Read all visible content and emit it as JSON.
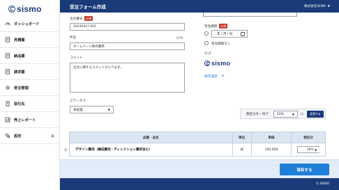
{
  "app": {
    "logo_text": "sismo"
  },
  "sidebar": {
    "items": [
      {
        "label": "ダッシュボード",
        "icon": "dashboard-icon",
        "has_plus": false
      },
      {
        "label": "見積書",
        "icon": "document-icon",
        "has_plus": false
      },
      {
        "label": "納品書",
        "icon": "document-icon",
        "has_plus": false
      },
      {
        "label": "請求書",
        "icon": "document-icon",
        "has_plus": false
      },
      {
        "label": "受注管理",
        "icon": "gear-icon",
        "has_plus": false
      },
      {
        "label": "取引先",
        "icon": "building-icon",
        "has_plus": false
      },
      {
        "label": "売上レポート",
        "icon": "report-icon",
        "has_plus": false
      },
      {
        "label": "設定",
        "icon": "settings-icon",
        "has_plus": true,
        "plus": "+"
      }
    ]
  },
  "header": {
    "title": "受注フォーム作成",
    "company": "株式会社SEWA",
    "caret": "▼"
  },
  "form": {
    "order_number_label": "注文番号",
    "required_badge": "必須",
    "order_number_value": "20240427-001",
    "subject_label": "件名",
    "subject_counter": "0/70",
    "subject_value": "ホームページ制作費用",
    "comment_label": "コメント",
    "comment_value": "注文に関するコメントが入ります。",
    "status_label": "ステータス",
    "status_value": "未処理",
    "validity_label": "有効期限",
    "validity_required": "必須",
    "date_value": "年 / 月 / 日",
    "no_deadline_label": "有効期限なし",
    "logo_label": "ロゴ",
    "logo_text": "sismo",
    "seal_link": "捺印設定",
    "seal_plus": "+"
  },
  "taxbar": {
    "label": "税区分を一括で",
    "value": "10%",
    "suffix": "に",
    "button": "変更する"
  },
  "table": {
    "headers": [
      "品番・品名",
      "単位",
      "単価",
      "税区分"
    ],
    "rows": [
      {
        "name": "デザイン費用（構成費用・ディレクション費用含む）",
        "unit": "式",
        "price": "150,000",
        "tax": "10%"
      }
    ]
  },
  "actions": {
    "save": "保存する"
  },
  "footer": {
    "copyright": "© SISMO"
  },
  "colors": {
    "navy": "#1a3a7a",
    "primary": "#1f7fd8",
    "required": "#c0392b",
    "link": "#1f6fd1"
  }
}
